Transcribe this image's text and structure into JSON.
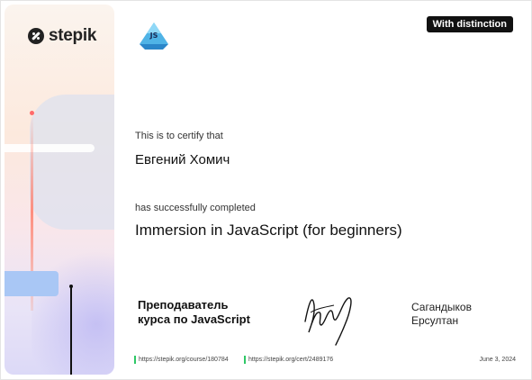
{
  "brand": {
    "name": "stepik",
    "logo_icon": "stepik-logo-icon"
  },
  "course_icon": {
    "text": "JS",
    "icon": "javascript-crystal-icon"
  },
  "badge": "With distinction",
  "certify_label": "This is to certify that",
  "recipient_name": "Евгений Хомич",
  "completed_label": "has successfully completed",
  "course_title": "Immersion in JavaScript (for beginners)",
  "instructor": {
    "role_line1": "Преподаватель",
    "role_line2": "курса по JavaScript",
    "name_line1": "Сагандыков",
    "name_line2": "Ерсултан"
  },
  "footer": {
    "course_url": "https://stepik.org/course/180784",
    "cert_url": "https://stepik.org/cert/2489176",
    "date": "June 3, 2024"
  },
  "colors": {
    "accent_green": "#2ec866",
    "badge_bg": "#111111"
  }
}
